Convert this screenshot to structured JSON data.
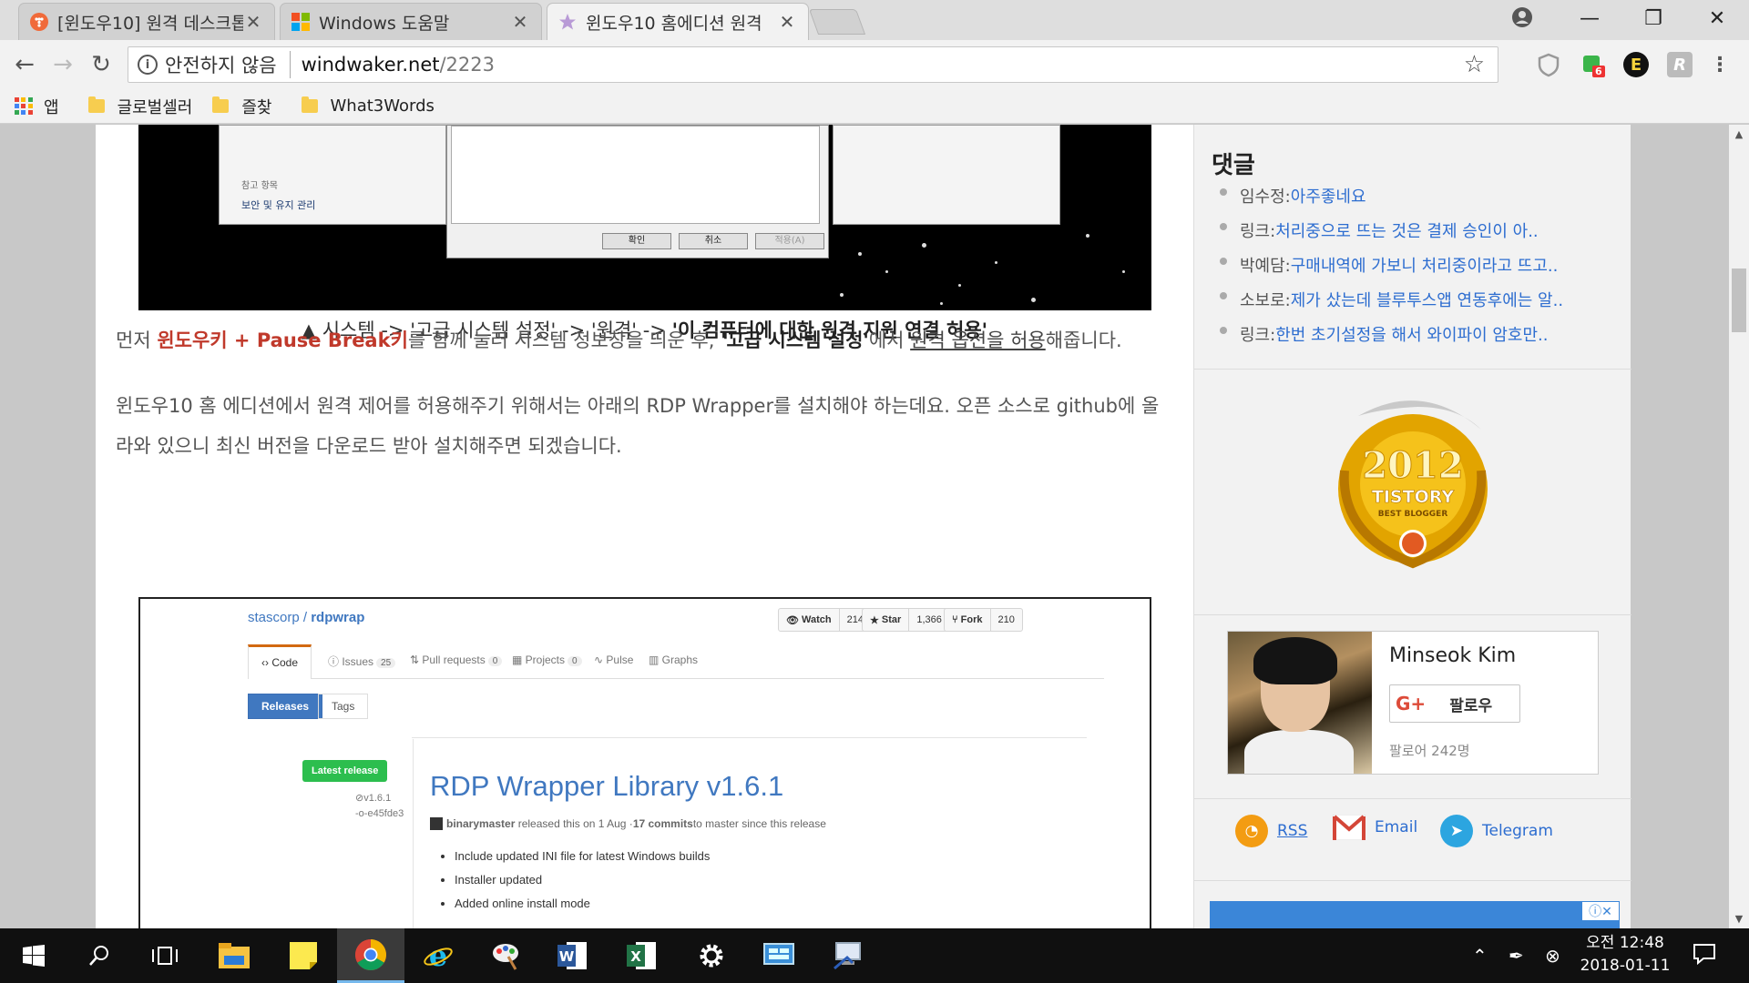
{
  "tabs": [
    {
      "title": "[윈도우10] 원격 데스크톱",
      "favicon": "tistory-icon",
      "close": "✕"
    },
    {
      "title": "Windows 도움말",
      "favicon": "windows-icon",
      "close": "✕"
    },
    {
      "title": "윈도우10 홈에디션 원격",
      "favicon": "star-icon",
      "close": "✕"
    }
  ],
  "window_controls": {
    "minimize": "—",
    "maximize": "❐",
    "close": "✕"
  },
  "address_bar": {
    "security_label": "안전하지 않음",
    "host": "windwaker.net",
    "path": "/2223"
  },
  "extensions": {
    "badge_count": "6"
  },
  "bookmarks": [
    {
      "label": "앱",
      "type": "apps"
    },
    {
      "label": "글로벌셀러",
      "type": "folder"
    },
    {
      "label": "즐찾",
      "type": "folder"
    },
    {
      "label": "What3Words",
      "type": "folder"
    }
  ],
  "article": {
    "screenshot1": {
      "ref_label": "참고 항목",
      "ref_link": "보안 및 유지 관리",
      "buttons": [
        "확인",
        "취소",
        "적용(A)"
      ]
    },
    "caption_plain": "▲ 시스템 -> '고급 시스템 설정' -> '원격' -> ",
    "caption_bold": "'이 컴퓨터에 대한 원격 지원 연결 허용'",
    "para1": {
      "p1": "먼저 ",
      "red": "윈도우키 + Pause Break키",
      "p2": "를 함께 눌러 시스템 정보창을 띄운 후, ",
      "strong": "'고급 시스템 설정'",
      "p3": "에서 ",
      "underline": "원격 옵션을 허용",
      "p4": "해줍니다."
    },
    "para2": "윈도우10 홈 에디션에서 원격 제어를 허용해주기 위해서는 아래의 RDP Wrapper를 설치해야 하는데요. 오픈 소스로 github에 올라와 있으니 최신 버전을 다운로드 받아 설치해주면 되겠습니다.",
    "github": {
      "owner": "stascorp",
      "repo": "rdpwrap",
      "watch": {
        "label": "Watch",
        "count": "214"
      },
      "star": {
        "label": "Star",
        "count": "1,366"
      },
      "fork": {
        "label": "Fork",
        "count": "210"
      },
      "tabs": [
        {
          "label": "Code",
          "count": ""
        },
        {
          "label": "Issues",
          "count": "25"
        },
        {
          "label": "Pull requests",
          "count": "0"
        },
        {
          "label": "Projects",
          "count": "0"
        },
        {
          "label": "Pulse",
          "count": ""
        },
        {
          "label": "Graphs",
          "count": ""
        }
      ],
      "seg_releases": "Releases",
      "seg_tags": "Tags",
      "latest_label": "Latest release",
      "tag": "v1.6.1",
      "commit": "e45fde3",
      "release_title": "RDP Wrapper Library v1.6.1",
      "release_author": "binarymaster",
      "release_meta": "released this on 1 Aug · ",
      "release_commits": "17 commits",
      "release_meta2": " to master since this release",
      "notes": [
        "Include updated INI file for latest Windows builds",
        "Installer updated",
        "Added online install mode"
      ]
    }
  },
  "sidebar": {
    "title": "댓글",
    "comments": [
      {
        "author": "임수정:",
        "text": "아주좋네요"
      },
      {
        "author": "링크:",
        "text": "처리중으로 뜨는 것은 결제 승인이 아.."
      },
      {
        "author": "박예담:",
        "text": "구매내역에 가보니 처리중이라고 뜨고.."
      },
      {
        "author": "소보로:",
        "text": "제가 샀는데 블루투스앱 연동후에는 알.."
      },
      {
        "author": "링크:",
        "text": "한번 초기설정을 해서 와이파이 암호만.."
      }
    ],
    "badge": {
      "year": "2012",
      "brand": "TISTORY",
      "sub": "BEST BLOGGER"
    },
    "profile": {
      "name": "Minseok Kim",
      "follow_label": "팔로우",
      "followers": "팔로어 242명"
    },
    "share": [
      {
        "label": "RSS",
        "icon": "rss-icon"
      },
      {
        "label": "Email",
        "icon": "gmail-icon"
      },
      {
        "label": "Telegram",
        "icon": "telegram-icon"
      }
    ],
    "ad_info": "ⓘ✕"
  },
  "taskbar": {
    "time": "오전 12:48",
    "date": "2018-01-11"
  },
  "colors": {
    "accent_red": "#c0392b",
    "link_blue": "#2d6dd0",
    "github_blue": "#4078c0",
    "github_green": "#2cbe4e"
  }
}
